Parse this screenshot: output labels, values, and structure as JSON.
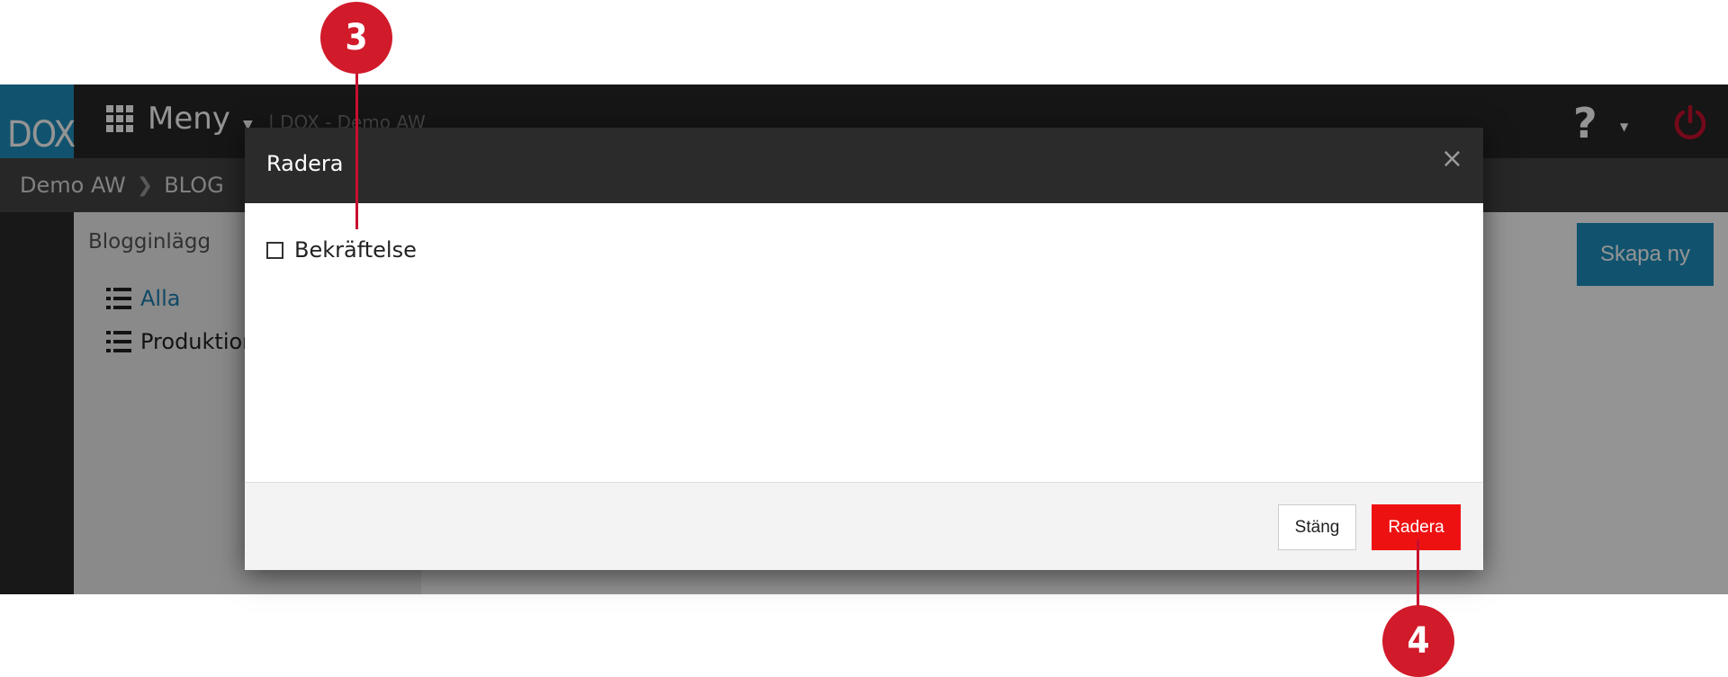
{
  "app": {
    "logo_text": "DOX",
    "menu_label": "Meny",
    "top_breadcrumb": "| DOX - Demo AW",
    "breadcrumb": [
      "Demo AW",
      "BLOG"
    ],
    "sidebar": {
      "title": "Blogginlägg",
      "items": [
        {
          "label": "Alla",
          "active": true
        },
        {
          "label": "Produktion",
          "active": false
        }
      ]
    },
    "create_button": "Skapa ny",
    "colors": {
      "brand": "#1e8fbd",
      "danger": "#ee1111",
      "power": "#c8102e"
    }
  },
  "modal": {
    "title": "Radera",
    "close_symbol": "×",
    "confirm_label": "Bekräftelse",
    "confirm_checked": false,
    "close_button": "Stäng",
    "delete_button": "Radera"
  },
  "callouts": [
    "3",
    "4"
  ]
}
